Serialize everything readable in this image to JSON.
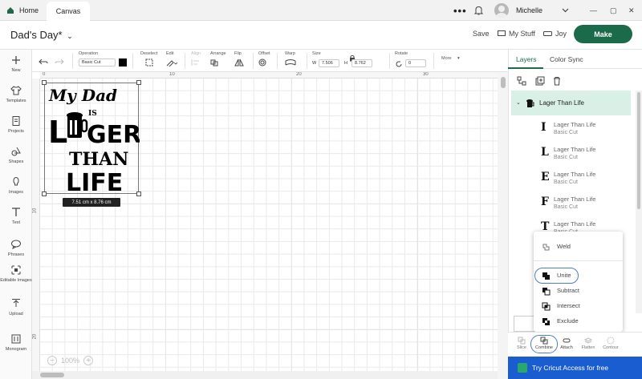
{
  "topbar": {
    "home_tab": "Home",
    "canvas_tab": "Canvas",
    "more": "•••",
    "user_name": "Michelle",
    "window_min": "—",
    "window_restore": "▢",
    "window_close": "✕"
  },
  "header": {
    "project_title": "Dad's Day*",
    "save": "Save",
    "my_stuff": "My Stuff",
    "machine": "Joy",
    "make": "Make"
  },
  "toolbar": {
    "operation_label": "Operation",
    "operation_value": "Basic Cut",
    "deselect_label": "Deselect",
    "edit_label": "Edit",
    "align_label": "Align",
    "arrange_label": "Arrange",
    "flip_label": "Flip",
    "offset_label": "Offset",
    "warp_label": "Warp",
    "size_label": "Size",
    "size_w_label": "W",
    "size_w": "7.506",
    "size_h_label": "H",
    "size_h": "8.762",
    "rotate_label": "Rotate",
    "rotate_value": "0",
    "more": "More"
  },
  "leftbar": {
    "items": [
      {
        "label": "New",
        "icon": "plus-icon"
      },
      {
        "label": "Templates",
        "icon": "shirt-icon"
      },
      {
        "label": "Projects",
        "icon": "projects-icon"
      },
      {
        "label": "Shapes",
        "icon": "shapes-icon"
      },
      {
        "label": "Images",
        "icon": "bulb-icon"
      },
      {
        "label": "Text",
        "icon": "text-icon"
      },
      {
        "label": "Phrases",
        "icon": "speech-icon"
      },
      {
        "label": "Editable Images",
        "icon": "editable-images-icon"
      },
      {
        "label": "Upload",
        "icon": "upload-icon"
      },
      {
        "label": "Monogram",
        "icon": "monogram-icon"
      }
    ]
  },
  "canvas": {
    "ruler_top": [
      "0",
      "10",
      "20",
      "30"
    ],
    "ruler_left": [
      "10",
      "20"
    ],
    "dimension_label": "7.51 cm x 8.76 cm",
    "zoom": "100%",
    "design_text": [
      "My Dad",
      "IS",
      "L",
      "GER",
      "THAN",
      "LIFE"
    ]
  },
  "panel": {
    "tabs": [
      "Layers",
      "Color Sync"
    ],
    "group_title": "Lager Than Life",
    "layers": [
      {
        "glyph": "I",
        "name": "Lager Than Life",
        "op": "Basic Cut"
      },
      {
        "glyph": "L",
        "name": "Lager Than Life",
        "op": "Basic Cut"
      },
      {
        "glyph": "E",
        "name": "Lager Than Life",
        "op": "Basic Cut"
      },
      {
        "glyph": "F",
        "name": "Lager Than Life",
        "op": "Basic Cut"
      },
      {
        "glyph": "T",
        "name": "Lager Than Life",
        "op": "Basic Cut"
      }
    ],
    "combine_menu": [
      "Weld",
      "Unite",
      "Subtract",
      "Intersect",
      "Exclude"
    ],
    "bottom": [
      "Slice",
      "Combine",
      "Attach",
      "Flatten",
      "Contour"
    ],
    "access": "Try Cricut Access for free"
  },
  "colors": {
    "accent": "#1b6b4a",
    "layer_highlight": "#d8f0e6",
    "access_blue": "#1a5dd0"
  }
}
